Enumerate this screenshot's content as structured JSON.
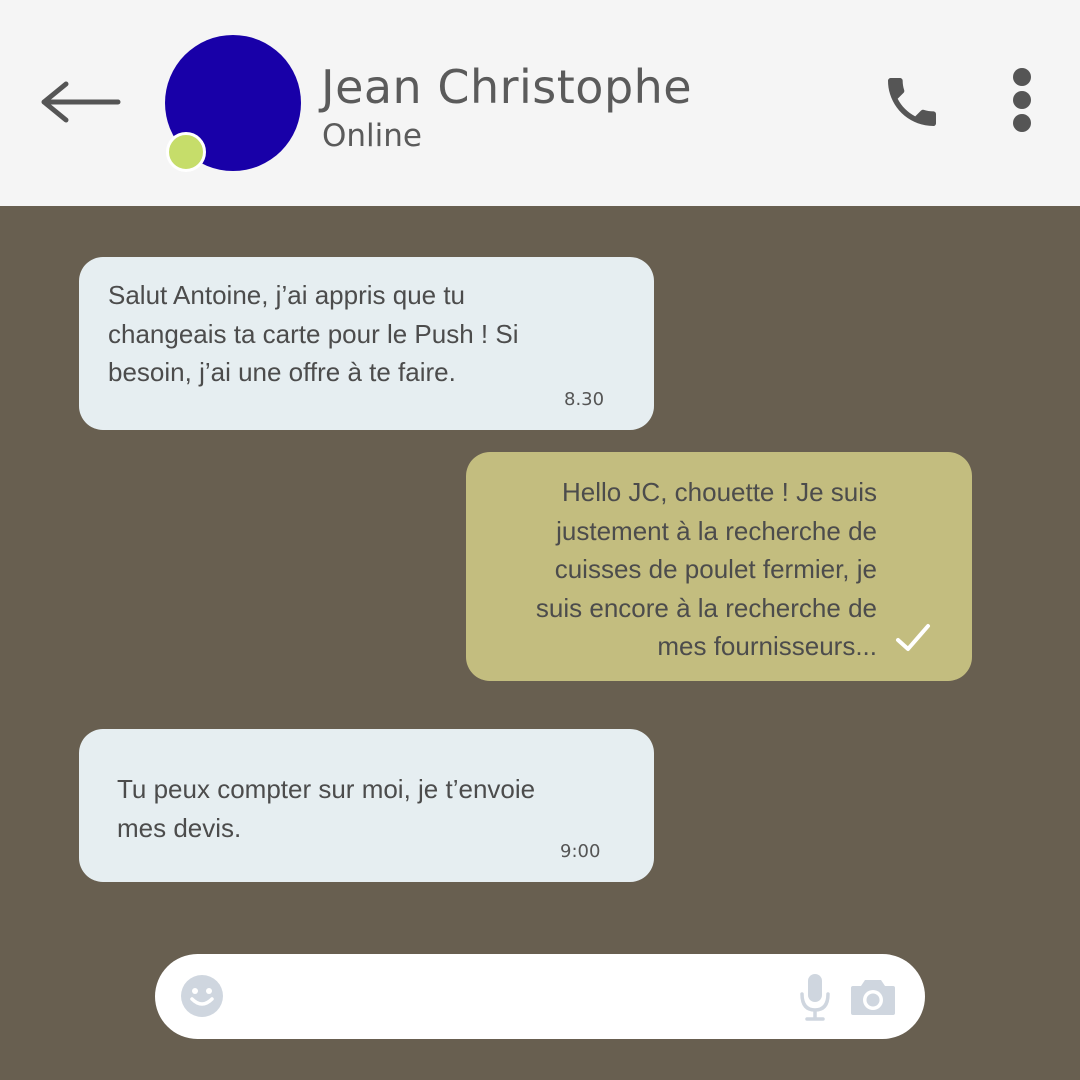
{
  "header": {
    "contact_name": "Jean Christophe",
    "contact_status": "Online",
    "avatar_color": "#1800a8",
    "status_color": "#c6dd6a",
    "icons": [
      "arrow-left-icon",
      "phone-icon",
      "more-vertical-icon"
    ]
  },
  "messages": [
    {
      "direction": "incoming",
      "text": "Salut Antoine, j’ai appris que tu\nchangeais ta carte pour le Push ! Si\nbesoin, j’ai une offre à te faire.",
      "time": "8.30"
    },
    {
      "direction": "outgoing",
      "text": "Hello JC, chouette ! Je suis\njustement à la recherche de\ncuisses de poulet fermier, je\nsuis encore à la recherche de\nmes fournisseurs...",
      "status_icon": "check-icon"
    },
    {
      "direction": "incoming",
      "text": "Tu peux compter sur moi, je t’envoie\nmes devis.",
      "time": "9:00"
    }
  ],
  "input_bar": {
    "placeholder": "",
    "icons": [
      "emoji-icon",
      "microphone-icon",
      "camera-icon"
    ]
  },
  "colors": {
    "chat_background": "#685f50",
    "header_background": "#f5f5f5",
    "incoming_bubble": "#e6eef1",
    "outgoing_bubble": "#c3bd7f"
  }
}
